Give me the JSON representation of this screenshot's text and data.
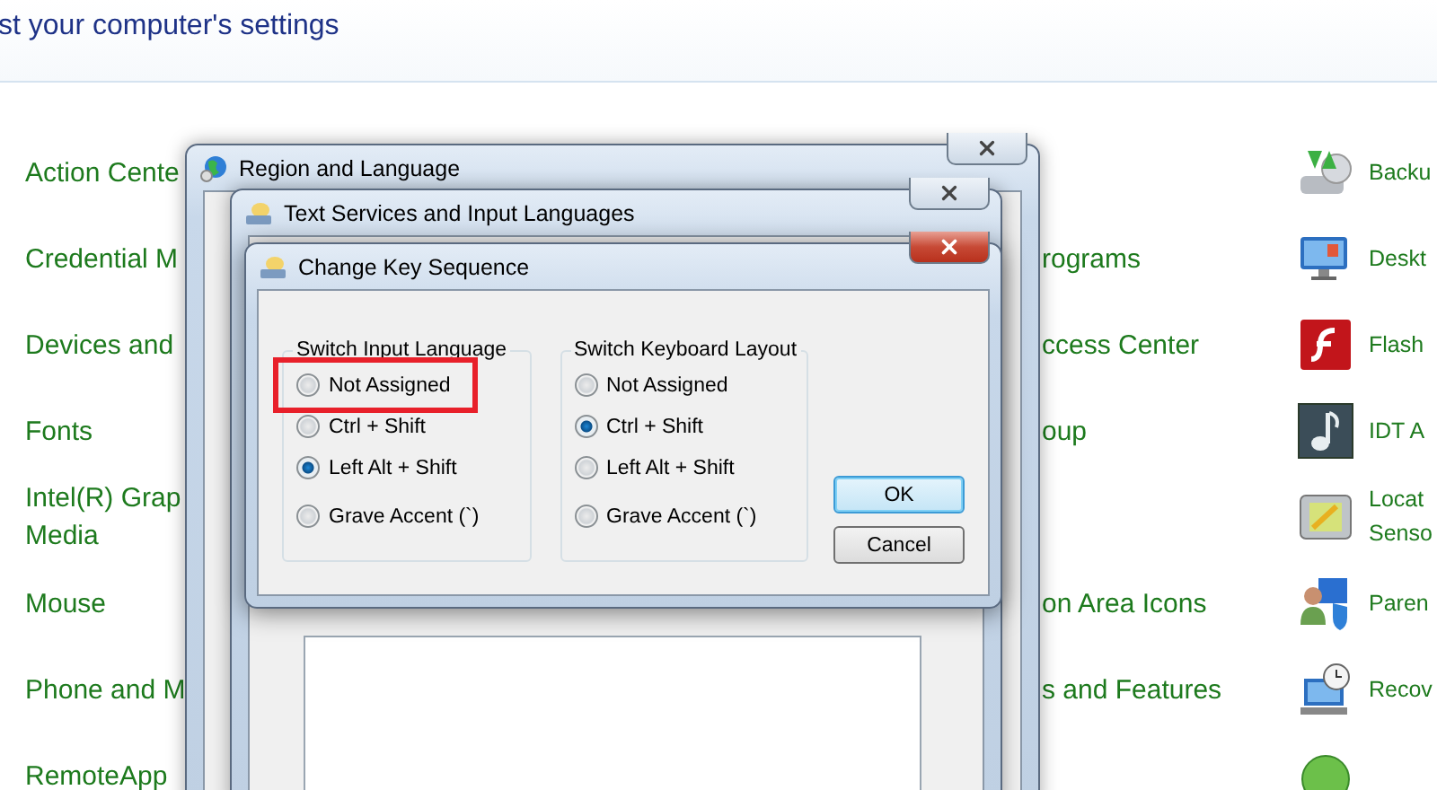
{
  "header": {
    "title": "st your computer's settings"
  },
  "left_column": [
    {
      "label": "Action Cente"
    },
    {
      "label": "Credential M"
    },
    {
      "label": "Devices and"
    },
    {
      "label": "Fonts"
    },
    {
      "label": "Intel(R) Grap\nMedia"
    },
    {
      "label": "Mouse"
    },
    {
      "label": "Phone and M"
    },
    {
      "label": "RemoteApp"
    }
  ],
  "middle_column": [
    {
      "kind": "blank"
    },
    {
      "kind": "text",
      "label": "rograms"
    },
    {
      "kind": "text",
      "label": "ccess Center"
    },
    {
      "kind": "text",
      "label": "oup"
    },
    {
      "kind": "blank"
    },
    {
      "kind": "text",
      "label": "on Area Icons"
    },
    {
      "kind": "text",
      "label": "s and Features"
    }
  ],
  "right_column": [
    {
      "kind": "backup",
      "label": "Backu"
    },
    {
      "kind": "desktop",
      "label": "Deskt"
    },
    {
      "kind": "flash",
      "label": "Flash"
    },
    {
      "kind": "music",
      "label": "IDT A"
    },
    {
      "kind": "location",
      "label": "Locat\nSenso"
    },
    {
      "kind": "parental",
      "label": "Paren"
    },
    {
      "kind": "recovery",
      "label": "Recov"
    },
    {
      "kind": "green"
    }
  ],
  "region_window": {
    "title": "Region and Language"
  },
  "services_window": {
    "title": "Text Services and Input Languages"
  },
  "dialog": {
    "title": "Change Key Sequence",
    "groups": [
      {
        "title": "Switch Input Language",
        "options": [
          {
            "label": "Not Assigned",
            "selected": false,
            "highlighted": true
          },
          {
            "label": "Ctrl + Shift",
            "selected": false,
            "highlighted": false
          },
          {
            "label": "Left Alt + Shift",
            "selected": true,
            "highlighted": false
          },
          {
            "label": "Grave Accent (`)",
            "selected": false,
            "highlighted": false
          }
        ]
      },
      {
        "title": "Switch Keyboard Layout",
        "options": [
          {
            "label": "Not Assigned",
            "selected": false,
            "highlighted": false
          },
          {
            "label": "Ctrl + Shift",
            "selected": true,
            "highlighted": false
          },
          {
            "label": "Left Alt + Shift",
            "selected": false,
            "highlighted": false
          },
          {
            "label": "Grave Accent (`)",
            "selected": false,
            "highlighted": false
          }
        ]
      }
    ],
    "buttons": [
      {
        "label": "OK",
        "default": true
      },
      {
        "label": "Cancel",
        "default": false
      }
    ]
  }
}
